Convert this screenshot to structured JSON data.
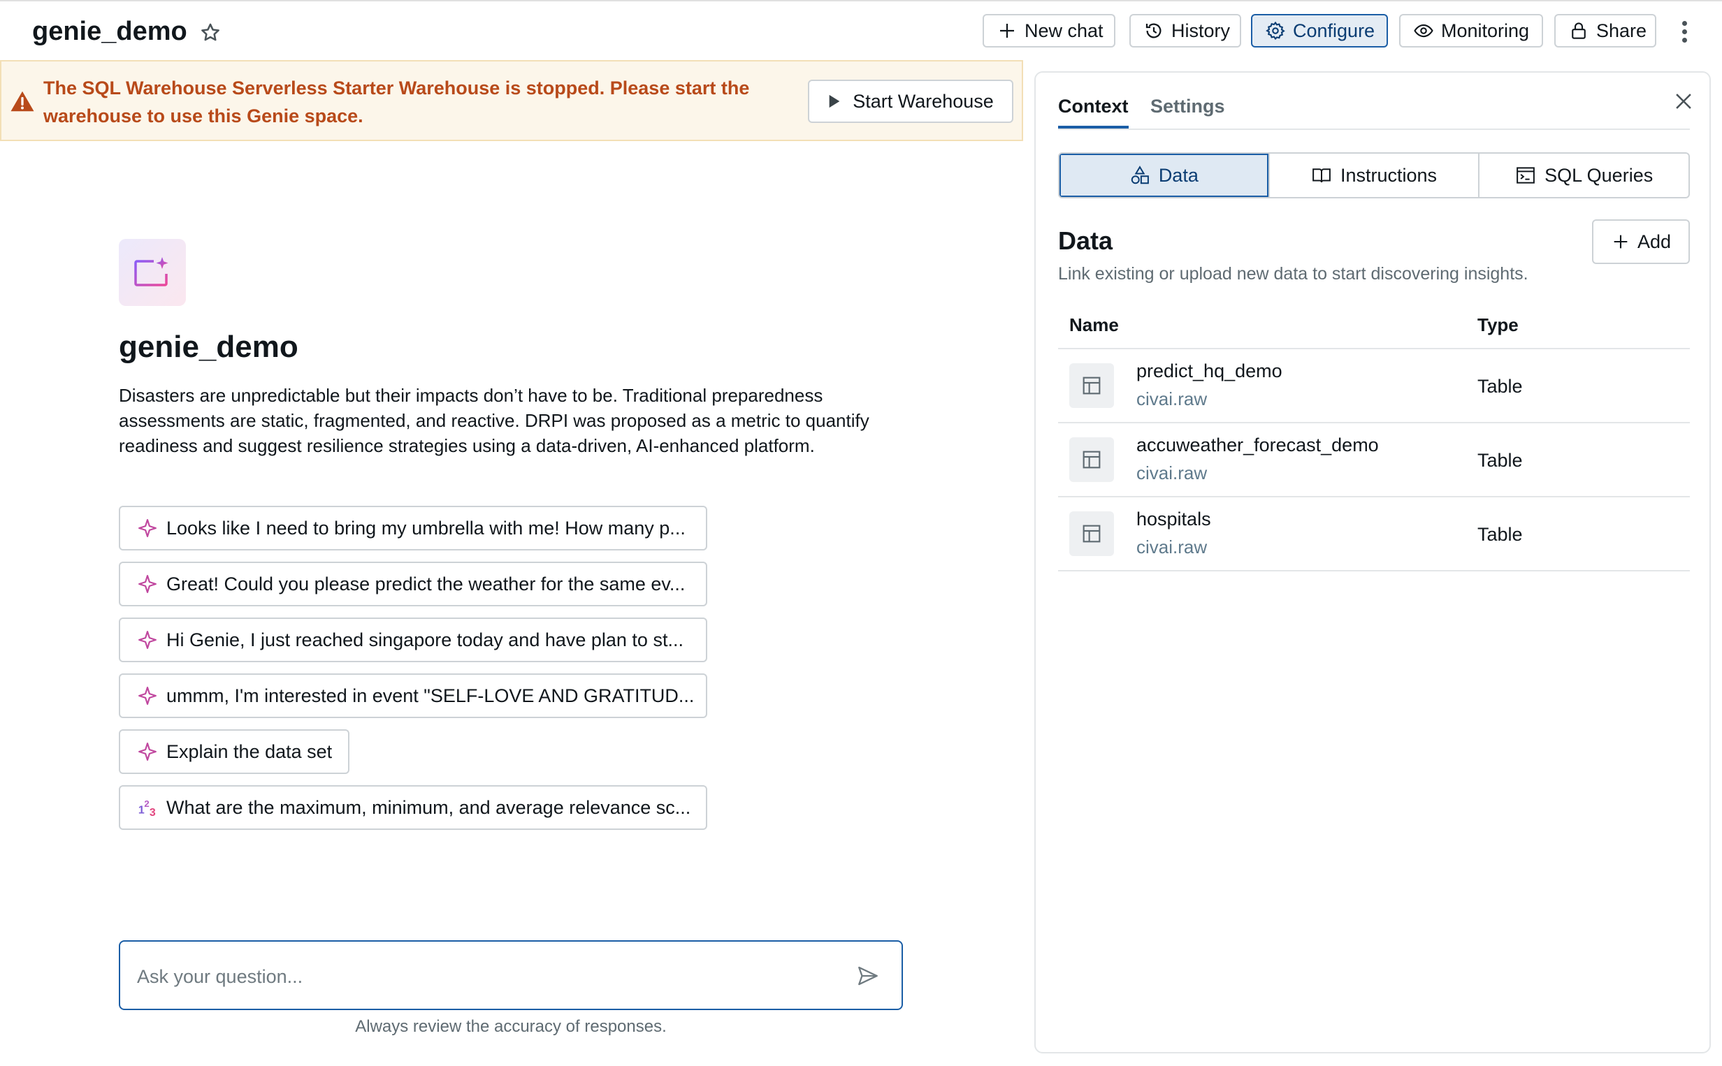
{
  "header": {
    "title": "genie_demo",
    "buttons": {
      "new_chat": "New chat",
      "history": "History",
      "configure": "Configure",
      "monitoring": "Monitoring",
      "share": "Share"
    }
  },
  "banner": {
    "message": "The SQL Warehouse Serverless Starter Warehouse is stopped. Please start the warehouse to use this Genie space.",
    "action": "Start Warehouse"
  },
  "space": {
    "title": "genie_demo",
    "description": "Disasters are unpredictable but their impacts don’t have to be. Traditional preparedness assessments are static, fragmented, and reactive. DRPI was proposed as a metric to quantify readiness and suggest resilience strategies using a data-driven, AI-enhanced platform."
  },
  "suggestions": [
    "Looks like I need to bring my umbrella with me! How many p...",
    "Great! Could you please predict the weather for the same ev...",
    "Hi Genie, I just reached singapore today and have plan to st...",
    "ummm, I'm interested in event \"SELF-LOVE AND GRATITUD...",
    "Explain the data set",
    "What are the maximum, minimum, and average relevance sc..."
  ],
  "chat_input": {
    "placeholder": "Ask your question...",
    "disclaimer": "Always review the accuracy of responses."
  },
  "panel": {
    "tabs": [
      "Context",
      "Settings"
    ],
    "segments": [
      "Data",
      "Instructions",
      "SQL Queries"
    ],
    "data_title": "Data",
    "data_subtitle": "Link existing or upload new data to start discovering insights.",
    "add_label": "Add",
    "table_headers": {
      "name": "Name",
      "type": "Type"
    },
    "rows": [
      {
        "name": "predict_hq_demo",
        "schema": "civai.raw",
        "type": "Table"
      },
      {
        "name": "accuweather_forecast_demo",
        "schema": "civai.raw",
        "type": "Table"
      },
      {
        "name": "hospitals",
        "schema": "civai.raw",
        "type": "Table"
      }
    ]
  },
  "colors": {
    "accent": "#1b5ea6",
    "warning_text": "#b84a1a",
    "warning_bg": "#fcf6ea",
    "sparkle": "#d946a8"
  }
}
